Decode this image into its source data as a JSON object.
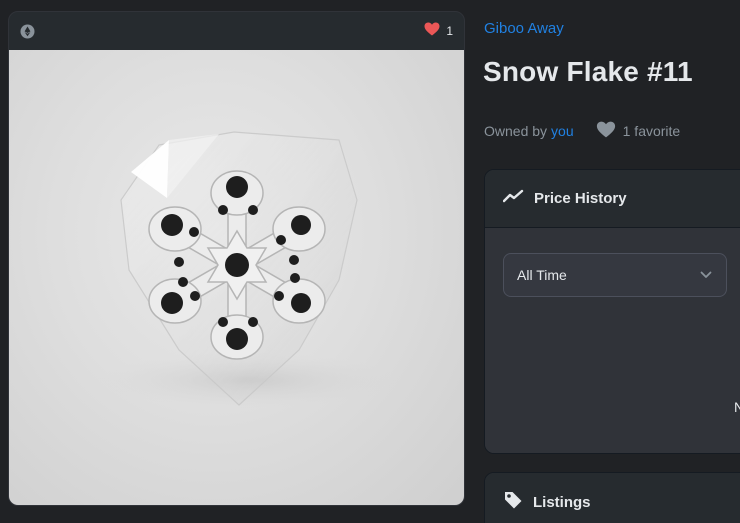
{
  "media": {
    "chain_icon": "ethereum-chain-icon",
    "favorite_icon": "heart-icon",
    "favorite_count": "1",
    "accent_heart": "#eb5757"
  },
  "asset": {
    "collection": "Giboo Away",
    "title": "Snow Flake #11",
    "owned_by_label": "Owned by",
    "owner": "you",
    "favorites_text": "1 favorite"
  },
  "price_history": {
    "icon": "trending-line-icon",
    "title": "Price History",
    "range_selected": "All Time",
    "range_icon": "chevron-down-icon",
    "truncated_text": "N"
  },
  "listings": {
    "icon": "tag-icon",
    "title": "Listings"
  },
  "colors": {
    "background": "#202225",
    "card": "#303339",
    "card_header": "#262b2f",
    "link": "#2081e2",
    "text": "#e5e8eb",
    "muted": "#8a939b"
  }
}
